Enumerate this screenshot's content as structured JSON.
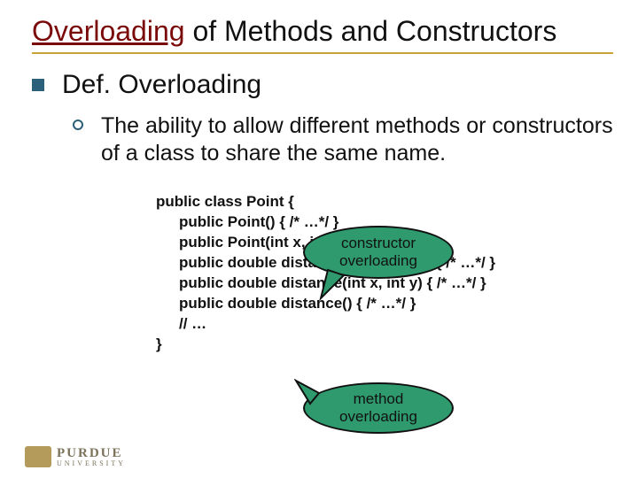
{
  "title": {
    "highlight": "Overloading",
    "rest": " of Methods and Constructors"
  },
  "bullet1": "Def. Overloading",
  "bullet2": "The ability to allow different methods or constructors of a class to share the same name.",
  "code": {
    "l1": "public class Point {",
    "l2": "public Point() { /* …*/ }",
    "l3": "public Point(int x, int y) { /* …*/ }",
    "l4": "public double distance(Point other) { /* …*/ }",
    "l5": "public double distance(int x, int y) { /* …*/ }",
    "l6": "public double distance() { /* …*/ }",
    "l7": "// …",
    "l8": "}"
  },
  "callouts": {
    "constructor": {
      "line1": "constructor",
      "line2": "overloading"
    },
    "method": {
      "line1": "method",
      "line2": "overloading"
    }
  },
  "logo": {
    "name": "PURDUE",
    "sub": "UNIVERSITY"
  }
}
